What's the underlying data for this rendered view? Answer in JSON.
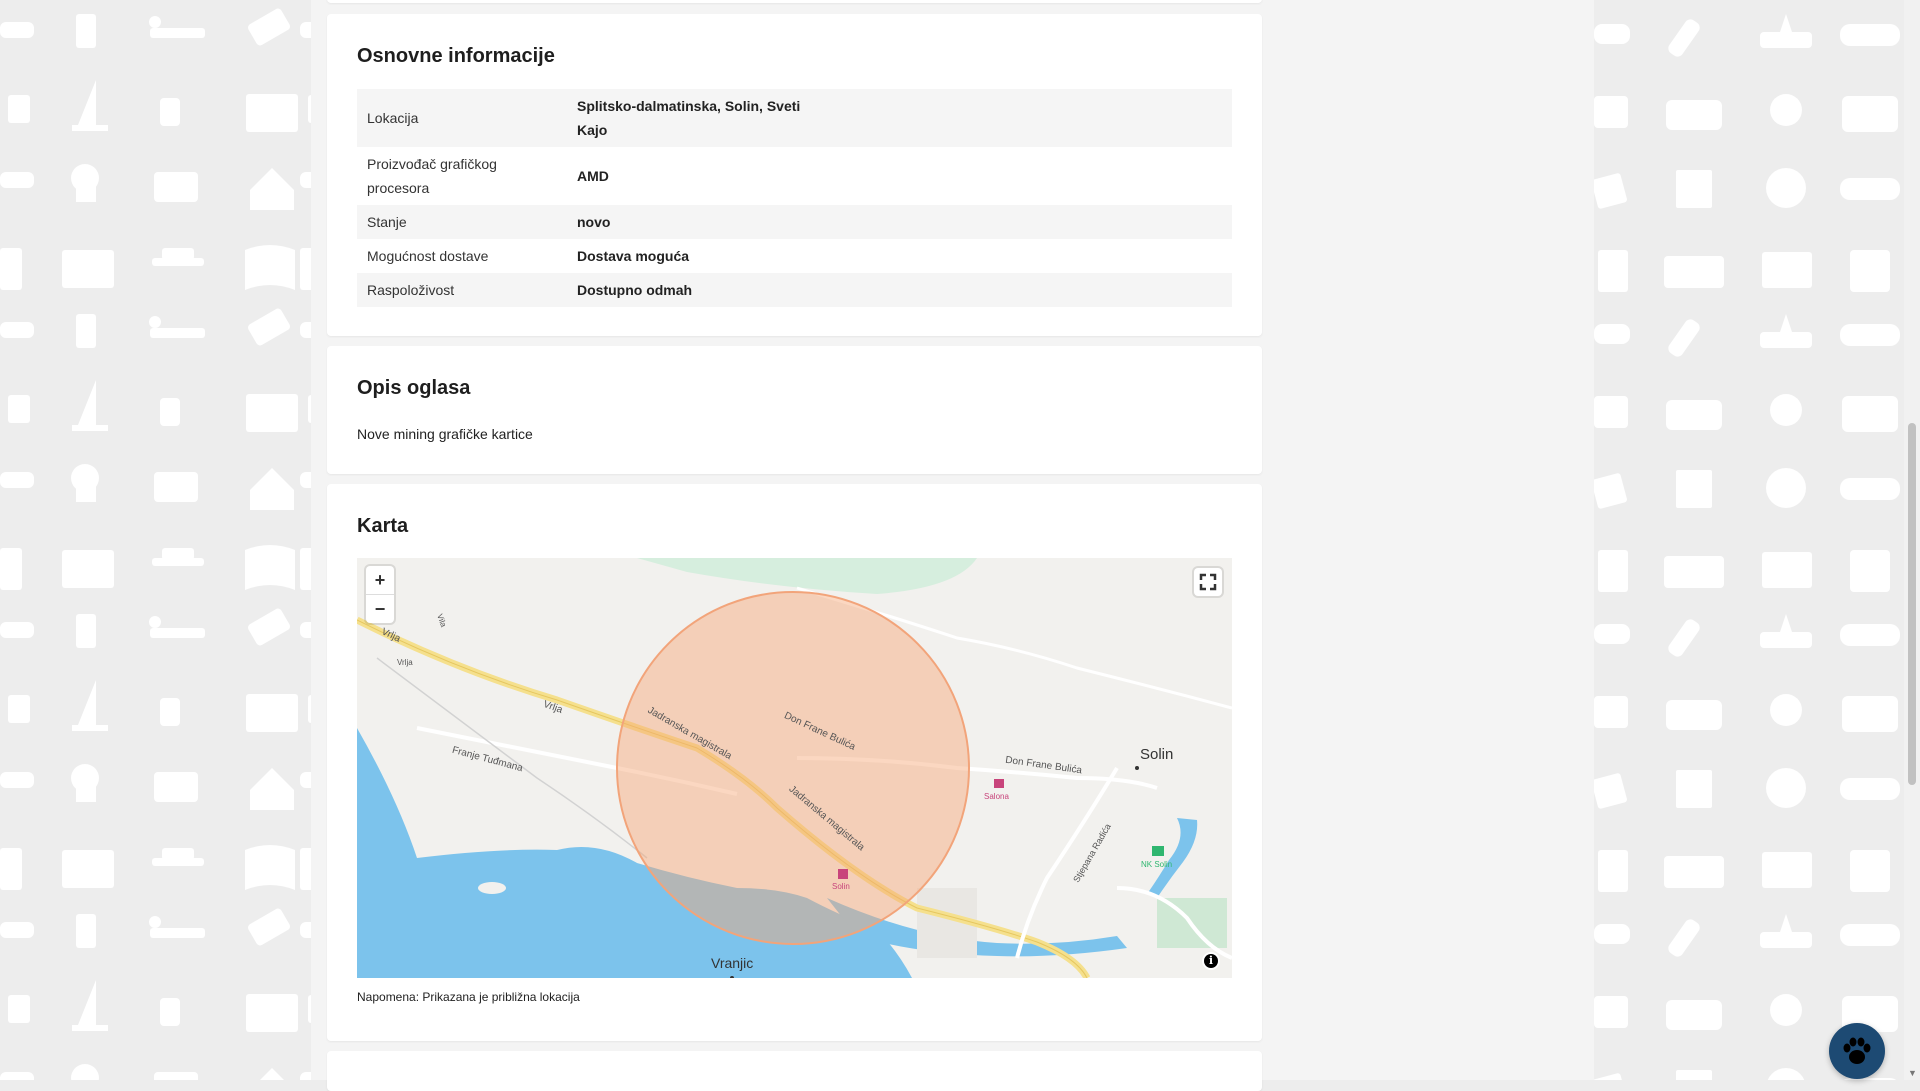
{
  "info_section": {
    "title": "Osnovne informacije",
    "rows": [
      {
        "label": "Lokacija",
        "value": "Splitsko-dalmatinska, Solin, Sveti Kajo"
      },
      {
        "label": "Proizvođač grafičkog procesora",
        "value": "AMD"
      },
      {
        "label": "Stanje",
        "value": "novo"
      },
      {
        "label": "Mogućnost dostave",
        "value": "Dostava moguća"
      },
      {
        "label": "Raspoloživost",
        "value": "Dostupno odmah"
      }
    ]
  },
  "description_section": {
    "title": "Opis oglasa",
    "text": "Nove mining grafičke kartice"
  },
  "map_section": {
    "title": "Karta",
    "zoom_in": "+",
    "zoom_out": "−",
    "info": "i",
    "note": "Napomena: Prikazana je približna lokacija",
    "labels": {
      "solin": "Solin",
      "vranjic": "Vranjic",
      "vrlja1": "Vrlja",
      "vrlja2": "Vrlja",
      "vrlja3": "Vrlja",
      "vila": "Vila",
      "jadranska1": "Jadranska magistrala",
      "jadranska2": "Jadranska magistrala",
      "don_frane1": "Don Frane Bulića",
      "don_frane2": "Don Frane Bulića",
      "franje": "Franje Tuđmana",
      "stjepana": "Stjepana Radića",
      "salona": "Salona",
      "solin_poi": "Solin",
      "nk_solin": "NK Solin"
    }
  },
  "colors": {
    "sea": "#7cc3ec",
    "circle": "#f7a776",
    "road": "#f5e08d",
    "chat": "#1d4a73"
  },
  "icons": [
    "plus-icon",
    "minus-icon",
    "fullscreen-icon",
    "info-icon",
    "paw-icon"
  ]
}
